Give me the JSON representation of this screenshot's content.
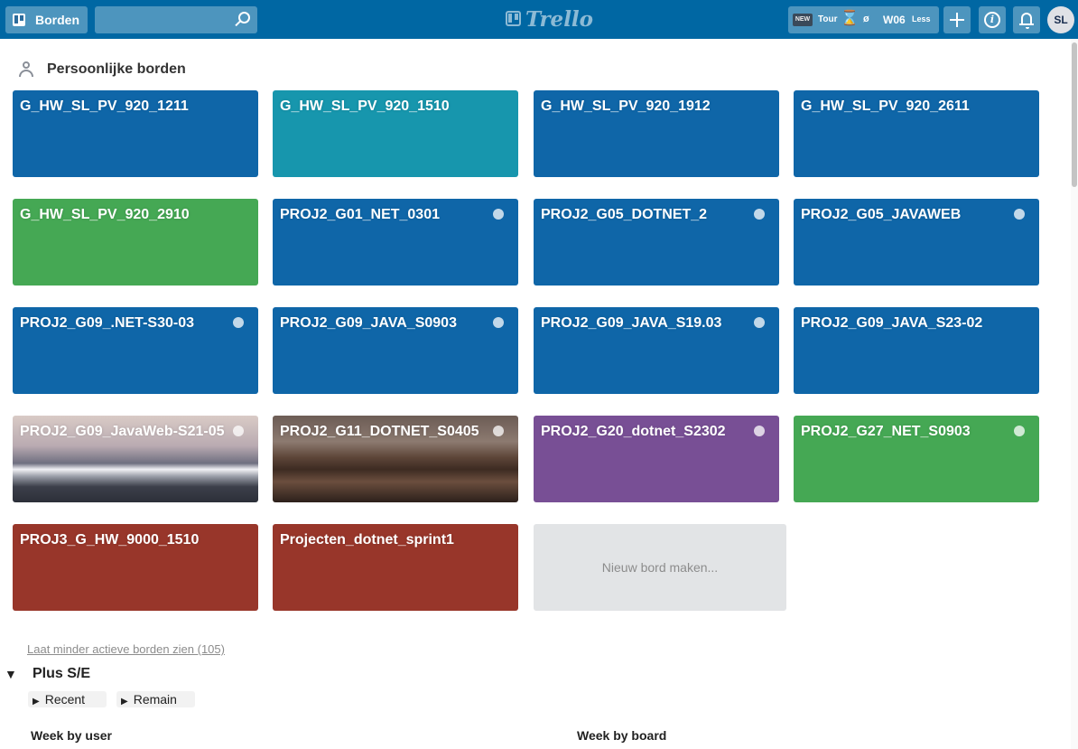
{
  "header": {
    "boards_label": "Borden",
    "search_placeholder": "",
    "logo_text": "Trello",
    "plugin": {
      "badge": "NEW",
      "tour": "Tour",
      "hourglass_icon": "⌛",
      "slash": "ø",
      "week": "W06",
      "less": "Less"
    },
    "info_icon": "i",
    "avatar_initials": "SL"
  },
  "section": {
    "title": "Persoonlijke borden"
  },
  "boards": [
    {
      "title": "G_HW_SL_PV_920_1211",
      "color": "#0f66a8",
      "starred": false
    },
    {
      "title": "G_HW_SL_PV_920_1510",
      "color": "#1796ad",
      "starred": false
    },
    {
      "title": "G_HW_SL_PV_920_1912",
      "color": "#0f66a8",
      "starred": false
    },
    {
      "title": "G_HW_SL_PV_920_2611",
      "color": "#0f66a8",
      "starred": false
    },
    {
      "title": "G_HW_SL_PV_920_2910",
      "color": "#45a854",
      "starred": false
    },
    {
      "title": "PROJ2_G01_NET_0301",
      "color": "#0f66a8",
      "starred": true
    },
    {
      "title": "PROJ2_G05_DOTNET_2",
      "color": "#0f66a8",
      "starred": true
    },
    {
      "title": "PROJ2_G05_JAVAWEB",
      "color": "#0f66a8",
      "starred": true
    },
    {
      "title": "PROJ2_G09_.NET-S30-03",
      "color": "#0f66a8",
      "starred": true
    },
    {
      "title": "PROJ2_G09_JAVA_S0903",
      "color": "#0f66a8",
      "starred": true
    },
    {
      "title": "PROJ2_G09_JAVA_S19.03",
      "color": "#0f66a8",
      "starred": true
    },
    {
      "title": "PROJ2_G09_JAVA_S23-02",
      "color": "#0f66a8",
      "starred": false
    },
    {
      "title": "PROJ2_G09_JavaWeb-S21-05",
      "color": "mountains-photo",
      "starred": true
    },
    {
      "title": "PROJ2_G11_DOTNET_S0405",
      "color": "desert-photo",
      "starred": true
    },
    {
      "title": "PROJ2_G20_dotnet_S2302",
      "color": "#784f95",
      "starred": true
    },
    {
      "title": "PROJ2_G27_NET_S0903",
      "color": "#45a854",
      "starred": true
    },
    {
      "title": "PROJ3_G_HW_9000_1510",
      "color": "#98362a",
      "starred": false
    },
    {
      "title": "Projecten_dotnet_sprint1",
      "color": "#98362a",
      "starred": false
    }
  ],
  "new_board_label": "Nieuw bord maken...",
  "less_active_link": "Laat minder actieve borden zien (105)",
  "plus": {
    "title": "Plus S/E",
    "triangle": "▼",
    "recent": "Recent",
    "remain": "Remain",
    "arrow": "▶",
    "week_by_user": "Week by user",
    "week_by_board": "Week by board"
  }
}
